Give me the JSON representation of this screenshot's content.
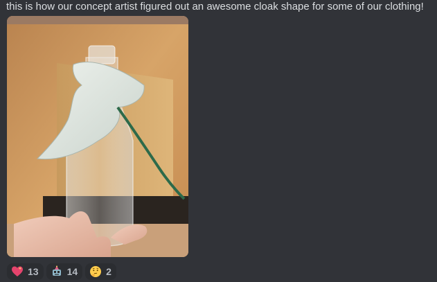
{
  "message": {
    "text": "this is how our concept artist figured out an awesome cloak shape for some of our clothing!"
  },
  "attachment": {
    "type": "image"
  },
  "reactions": [
    {
      "emoji": "heart-with-sparkle-icon",
      "count": "13"
    },
    {
      "emoji": "robot-party-icon",
      "count": "14"
    },
    {
      "emoji": "thinking-face-icon",
      "count": "2"
    }
  ],
  "colors": {
    "background": "#313338",
    "text": "#dbdee1",
    "reaction_bg": "#2b2d31",
    "reaction_text": "#b5bac1"
  }
}
